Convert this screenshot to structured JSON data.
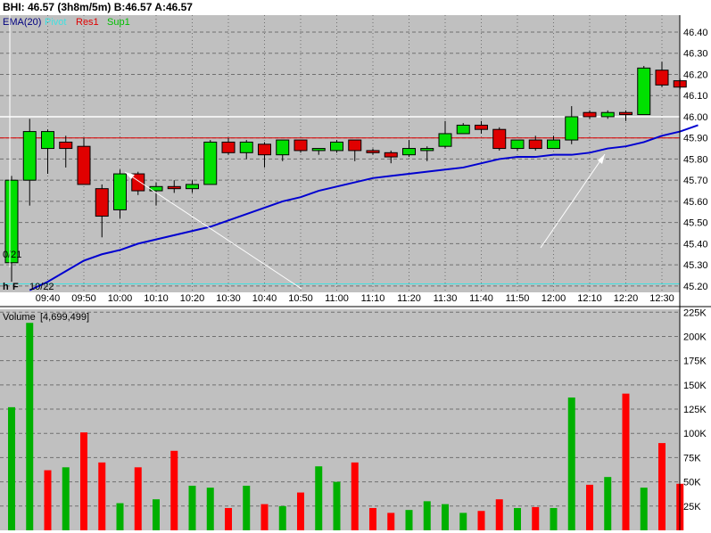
{
  "header": {
    "title": "BHI: 46.57 (3h8m/5m)  B:46.57  A:46.57"
  },
  "colors": {
    "background": "#c0c0c0",
    "up": "#00e000",
    "down": "#e00000",
    "ema": "#0000d0",
    "pivot": "#40e0e0",
    "res1": "#e00000",
    "sup1": "#00c000",
    "grid": "#707070",
    "white_line": "#ffffff",
    "volume_up": "#00b000",
    "volume_down": "#ff0000"
  },
  "chart_data": [
    {
      "type": "candlestick",
      "legend": {
        "ema": "EMA(20)",
        "pivot": "Pivot",
        "res1": "Res1",
        "sup1": "Sup1"
      },
      "ylim": [
        45.17,
        46.48
      ],
      "yticks": [
        "46.40",
        "46.30",
        "46.20",
        "46.10",
        "46.00",
        "45.90",
        "45.80",
        "45.70",
        "45.60",
        "45.50",
        "45.40",
        "45.30",
        "45.20"
      ],
      "ytick_values": [
        46.4,
        46.3,
        46.2,
        46.1,
        46.0,
        45.9,
        45.8,
        45.7,
        45.6,
        45.5,
        45.4,
        45.3,
        45.2
      ],
      "xticks": [
        "09:40",
        "09:50",
        "10:00",
        "10:10",
        "10:20",
        "10:30",
        "10:40",
        "10:50",
        "11:00",
        "11:10",
        "11:20",
        "11:30",
        "11:40",
        "11:50",
        "12:00",
        "12:10",
        "12:20",
        "12:30"
      ],
      "date_labels": [
        "0/21",
        "10/22"
      ],
      "markers": [
        "h",
        "F"
      ],
      "res1_level": 45.9,
      "white_level": 46.0,
      "pivot_level": 45.21,
      "candles": [
        {
          "o": 45.31,
          "h": 45.72,
          "l": 45.22,
          "c": 45.7
        },
        {
          "o": 45.7,
          "h": 45.99,
          "l": 45.58,
          "c": 45.93
        },
        {
          "o": 45.85,
          "h": 45.94,
          "l": 45.73,
          "c": 45.93
        },
        {
          "o": 45.88,
          "h": 45.91,
          "l": 45.76,
          "c": 45.85
        },
        {
          "o": 45.86,
          "h": 45.9,
          "l": 45.68,
          "c": 45.68
        },
        {
          "o": 45.66,
          "h": 45.68,
          "l": 45.43,
          "c": 45.53
        },
        {
          "o": 45.56,
          "h": 45.75,
          "l": 45.52,
          "c": 45.73
        },
        {
          "o": 45.73,
          "h": 45.74,
          "l": 45.63,
          "c": 45.65
        },
        {
          "o": 45.65,
          "h": 45.69,
          "l": 45.58,
          "c": 45.67
        },
        {
          "o": 45.67,
          "h": 45.7,
          "l": 45.64,
          "c": 45.66
        },
        {
          "o": 45.66,
          "h": 45.7,
          "l": 45.64,
          "c": 45.68
        },
        {
          "o": 45.68,
          "h": 45.89,
          "l": 45.68,
          "c": 45.88
        },
        {
          "o": 45.88,
          "h": 45.9,
          "l": 45.82,
          "c": 45.83
        },
        {
          "o": 45.83,
          "h": 45.89,
          "l": 45.8,
          "c": 45.88
        },
        {
          "o": 45.87,
          "h": 45.88,
          "l": 45.76,
          "c": 45.82
        },
        {
          "o": 45.82,
          "h": 45.89,
          "l": 45.79,
          "c": 45.89
        },
        {
          "o": 45.89,
          "h": 45.89,
          "l": 45.83,
          "c": 45.84
        },
        {
          "o": 45.84,
          "h": 45.85,
          "l": 45.82,
          "c": 45.85
        },
        {
          "o": 45.84,
          "h": 45.89,
          "l": 45.83,
          "c": 45.88
        },
        {
          "o": 45.89,
          "h": 45.89,
          "l": 45.79,
          "c": 45.84
        },
        {
          "o": 45.84,
          "h": 45.85,
          "l": 45.82,
          "c": 45.83
        },
        {
          "o": 45.83,
          "h": 45.84,
          "l": 45.78,
          "c": 45.81
        },
        {
          "o": 45.82,
          "h": 45.89,
          "l": 45.81,
          "c": 45.85
        },
        {
          "o": 45.84,
          "h": 45.86,
          "l": 45.79,
          "c": 45.85
        },
        {
          "o": 45.86,
          "h": 45.98,
          "l": 45.85,
          "c": 45.92
        },
        {
          "o": 45.92,
          "h": 45.97,
          "l": 45.92,
          "c": 45.96
        },
        {
          "o": 45.96,
          "h": 45.98,
          "l": 45.92,
          "c": 45.94
        },
        {
          "o": 45.94,
          "h": 45.95,
          "l": 45.84,
          "c": 45.85
        },
        {
          "o": 45.85,
          "h": 45.89,
          "l": 45.84,
          "c": 45.89
        },
        {
          "o": 45.89,
          "h": 45.91,
          "l": 45.84,
          "c": 45.85
        },
        {
          "o": 45.85,
          "h": 45.91,
          "l": 45.85,
          "c": 45.89
        },
        {
          "o": 45.89,
          "h": 46.05,
          "l": 45.87,
          "c": 46.0
        },
        {
          "o": 46.02,
          "h": 46.03,
          "l": 45.99,
          "c": 46.0
        },
        {
          "o": 46.0,
          "h": 46.03,
          "l": 45.99,
          "c": 46.02
        },
        {
          "o": 46.02,
          "h": 46.03,
          "l": 45.98,
          "c": 46.01
        },
        {
          "o": 46.01,
          "h": 46.24,
          "l": 46.01,
          "c": 46.23
        },
        {
          "o": 46.22,
          "h": 46.26,
          "l": 46.14,
          "c": 46.15
        },
        {
          "o": 46.17,
          "h": 46.18,
          "l": 46.13,
          "c": 46.14
        }
      ],
      "ema_values": [
        45.18,
        45.22,
        45.27,
        45.32,
        45.35,
        45.37,
        45.4,
        45.42,
        45.44,
        45.46,
        45.48,
        45.51,
        45.54,
        45.57,
        45.6,
        45.62,
        45.65,
        45.67,
        45.69,
        45.71,
        45.72,
        45.73,
        45.74,
        45.75,
        45.76,
        45.78,
        45.8,
        45.81,
        45.81,
        45.82,
        45.82,
        45.83,
        45.85,
        45.86,
        45.88,
        45.91,
        45.93,
        45.96
      ]
    },
    {
      "type": "bar",
      "title": "Volume",
      "subtitle": "[4,699,499]",
      "ylim": [
        0,
        228000
      ],
      "yticks": [
        "225K",
        "200K",
        "175K",
        "150K",
        "125K",
        "100K",
        "75K",
        "50K",
        "25K"
      ],
      "ytick_values": [
        225000,
        200000,
        175000,
        150000,
        125000,
        100000,
        75000,
        50000,
        25000
      ],
      "values": [
        127000,
        214000,
        62000,
        65000,
        101000,
        70000,
        28000,
        65000,
        32000,
        82000,
        46000,
        44000,
        23000,
        46000,
        27000,
        25000,
        39000,
        66000,
        50000,
        70000,
        23000,
        18000,
        21000,
        30000,
        27000,
        18000,
        20000,
        32000,
        23000,
        24000,
        23000,
        137000,
        47000,
        55000,
        141000,
        44000,
        90000,
        48000
      ],
      "directions": [
        "up",
        "up",
        "down",
        "up",
        "down",
        "down",
        "up",
        "down",
        "up",
        "down",
        "up",
        "up",
        "down",
        "up",
        "down",
        "up",
        "down",
        "up",
        "up",
        "down",
        "down",
        "down",
        "up",
        "up",
        "up",
        "up",
        "down",
        "down",
        "up",
        "down",
        "up",
        "up",
        "down",
        "up",
        "down",
        "up",
        "down",
        "down"
      ]
    }
  ]
}
